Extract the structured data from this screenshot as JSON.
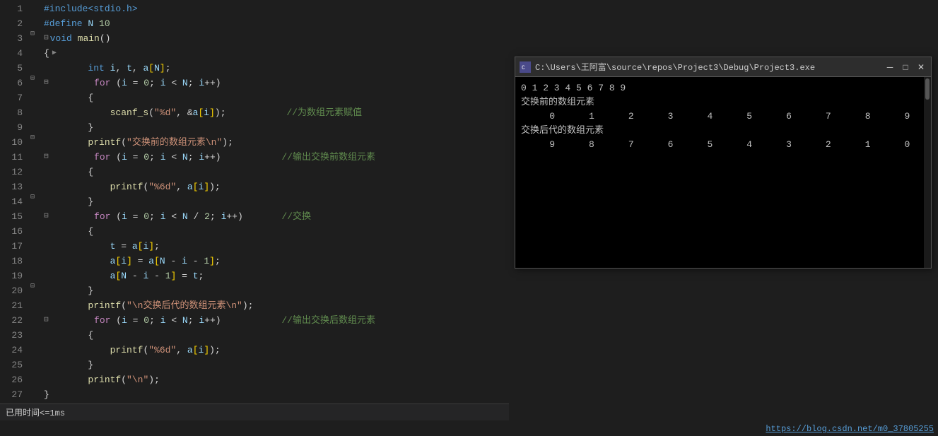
{
  "editor": {
    "background": "#1e1e1e",
    "lines": [
      {
        "num": 1,
        "fold": false,
        "content": [
          {
            "t": "pp",
            "v": "#include<stdio.h>"
          }
        ]
      },
      {
        "num": 2,
        "fold": false,
        "content": [
          {
            "t": "pp",
            "v": "#define "
          },
          {
            "t": "var",
            "v": "N"
          },
          {
            "t": "plain",
            "v": " "
          },
          {
            "t": "num",
            "v": "10"
          }
        ]
      },
      {
        "num": 3,
        "fold": true,
        "content": [
          {
            "t": "kw",
            "v": "void"
          },
          {
            "t": "plain",
            "v": " "
          },
          {
            "t": "fn",
            "v": "main"
          },
          {
            "t": "plain",
            "v": "()"
          }
        ]
      },
      {
        "num": 4,
        "fold": false,
        "content": [
          {
            "t": "plain",
            "v": "{"
          },
          {
            "t": "plain",
            "v": " "
          },
          {
            "t": "plain",
            "v": "▶"
          }
        ]
      },
      {
        "num": 5,
        "fold": false,
        "content": [
          {
            "t": "plain",
            "v": "        "
          },
          {
            "t": "kw",
            "v": "int"
          },
          {
            "t": "plain",
            "v": " "
          },
          {
            "t": "var",
            "v": "i"
          },
          {
            "t": "plain",
            "v": ", "
          },
          {
            "t": "var",
            "v": "t"
          },
          {
            "t": "plain",
            "v": ", "
          },
          {
            "t": "var",
            "v": "a"
          },
          {
            "t": "bracket",
            "v": "["
          },
          {
            "t": "var",
            "v": "N"
          },
          {
            "t": "bracket",
            "v": "]"
          },
          {
            "t": "plain",
            "v": ";"
          }
        ]
      },
      {
        "num": 6,
        "fold": true,
        "content": [
          {
            "t": "plain",
            "v": "        "
          },
          {
            "t": "kw2",
            "v": "for"
          },
          {
            "t": "plain",
            "v": " ("
          },
          {
            "t": "var",
            "v": "i"
          },
          {
            "t": "plain",
            "v": " = "
          },
          {
            "t": "num",
            "v": "0"
          },
          {
            "t": "plain",
            "v": "; "
          },
          {
            "t": "var",
            "v": "i"
          },
          {
            "t": "plain",
            "v": " < "
          },
          {
            "t": "var",
            "v": "N"
          },
          {
            "t": "plain",
            "v": "; "
          },
          {
            "t": "var",
            "v": "i"
          },
          {
            "t": "plain",
            "v": "++)"
          }
        ]
      },
      {
        "num": 7,
        "fold": false,
        "content": [
          {
            "t": "plain",
            "v": "        {"
          }
        ]
      },
      {
        "num": 8,
        "fold": false,
        "content": [
          {
            "t": "plain",
            "v": "            "
          },
          {
            "t": "fn",
            "v": "scanf_s"
          },
          {
            "t": "plain",
            "v": "("
          },
          {
            "t": "str",
            "v": "\"%d\""
          },
          {
            "t": "plain",
            "v": ", &"
          },
          {
            "t": "var",
            "v": "a"
          },
          {
            "t": "bracket",
            "v": "["
          },
          {
            "t": "var",
            "v": "i"
          },
          {
            "t": "bracket",
            "v": "]"
          },
          {
            "t": "plain",
            "v": ");           "
          },
          {
            "t": "comment",
            "v": "//为数组元素赋值"
          }
        ]
      },
      {
        "num": 9,
        "fold": false,
        "content": [
          {
            "t": "plain",
            "v": "        }"
          }
        ]
      },
      {
        "num": 10,
        "fold": false,
        "content": [
          {
            "t": "plain",
            "v": "        "
          },
          {
            "t": "fn",
            "v": "printf"
          },
          {
            "t": "plain",
            "v": "("
          },
          {
            "t": "str",
            "v": "\"交换前的数组元素\\n\""
          },
          {
            "t": "plain",
            "v": ");"
          }
        ]
      },
      {
        "num": 11,
        "fold": true,
        "content": [
          {
            "t": "plain",
            "v": "        "
          },
          {
            "t": "kw2",
            "v": "for"
          },
          {
            "t": "plain",
            "v": " ("
          },
          {
            "t": "var",
            "v": "i"
          },
          {
            "t": "plain",
            "v": " = "
          },
          {
            "t": "num",
            "v": "0"
          },
          {
            "t": "plain",
            "v": "; "
          },
          {
            "t": "var",
            "v": "i"
          },
          {
            "t": "plain",
            "v": " < "
          },
          {
            "t": "var",
            "v": "N"
          },
          {
            "t": "plain",
            "v": "; "
          },
          {
            "t": "var",
            "v": "i"
          },
          {
            "t": "plain",
            "v": "++)           "
          },
          {
            "t": "comment",
            "v": "//输出交换前数组元素"
          }
        ]
      },
      {
        "num": 12,
        "fold": false,
        "content": [
          {
            "t": "plain",
            "v": "        {"
          }
        ]
      },
      {
        "num": 13,
        "fold": false,
        "content": [
          {
            "t": "plain",
            "v": "            "
          },
          {
            "t": "fn",
            "v": "printf"
          },
          {
            "t": "plain",
            "v": "("
          },
          {
            "t": "str",
            "v": "\"%6d\""
          },
          {
            "t": "plain",
            "v": ", "
          },
          {
            "t": "var",
            "v": "a"
          },
          {
            "t": "bracket",
            "v": "["
          },
          {
            "t": "var",
            "v": "i"
          },
          {
            "t": "bracket",
            "v": "]"
          },
          {
            "t": "plain",
            "v": ");"
          }
        ]
      },
      {
        "num": 14,
        "fold": false,
        "content": [
          {
            "t": "plain",
            "v": "        }"
          }
        ]
      },
      {
        "num": 15,
        "fold": true,
        "content": [
          {
            "t": "plain",
            "v": "        "
          },
          {
            "t": "kw2",
            "v": "for"
          },
          {
            "t": "plain",
            "v": " ("
          },
          {
            "t": "var",
            "v": "i"
          },
          {
            "t": "plain",
            "v": " = "
          },
          {
            "t": "num",
            "v": "0"
          },
          {
            "t": "plain",
            "v": "; "
          },
          {
            "t": "var",
            "v": "i"
          },
          {
            "t": "plain",
            "v": " < "
          },
          {
            "t": "var",
            "v": "N"
          },
          {
            "t": "plain",
            "v": " / "
          },
          {
            "t": "num",
            "v": "2"
          },
          {
            "t": "plain",
            "v": "; "
          },
          {
            "t": "var",
            "v": "i"
          },
          {
            "t": "plain",
            "v": "++)       "
          },
          {
            "t": "comment",
            "v": "//交换"
          }
        ]
      },
      {
        "num": 16,
        "fold": false,
        "content": [
          {
            "t": "plain",
            "v": "        {"
          }
        ]
      },
      {
        "num": 17,
        "fold": false,
        "content": [
          {
            "t": "plain",
            "v": "            "
          },
          {
            "t": "var",
            "v": "t"
          },
          {
            "t": "plain",
            "v": " = "
          },
          {
            "t": "var",
            "v": "a"
          },
          {
            "t": "bracket",
            "v": "["
          },
          {
            "t": "var",
            "v": "i"
          },
          {
            "t": "bracket",
            "v": "]"
          },
          {
            "t": "plain",
            "v": ";"
          }
        ]
      },
      {
        "num": 18,
        "fold": false,
        "content": [
          {
            "t": "plain",
            "v": "            "
          },
          {
            "t": "var",
            "v": "a"
          },
          {
            "t": "bracket",
            "v": "["
          },
          {
            "t": "var",
            "v": "i"
          },
          {
            "t": "bracket",
            "v": "]"
          },
          {
            "t": "plain",
            "v": " = "
          },
          {
            "t": "var",
            "v": "a"
          },
          {
            "t": "bracket",
            "v": "["
          },
          {
            "t": "var",
            "v": "N"
          },
          {
            "t": "plain",
            "v": " - "
          },
          {
            "t": "var",
            "v": "i"
          },
          {
            "t": "plain",
            "v": " - "
          },
          {
            "t": "num",
            "v": "1"
          },
          {
            "t": "bracket",
            "v": "]"
          },
          {
            "t": "plain",
            "v": ";"
          }
        ]
      },
      {
        "num": 19,
        "fold": false,
        "content": [
          {
            "t": "plain",
            "v": "            "
          },
          {
            "t": "var",
            "v": "a"
          },
          {
            "t": "bracket",
            "v": "["
          },
          {
            "t": "var",
            "v": "N"
          },
          {
            "t": "plain",
            "v": " - "
          },
          {
            "t": "var",
            "v": "i"
          },
          {
            "t": "plain",
            "v": " - "
          },
          {
            "t": "num",
            "v": "1"
          },
          {
            "t": "bracket",
            "v": "]"
          },
          {
            "t": "plain",
            "v": " = "
          },
          {
            "t": "var",
            "v": "t"
          },
          {
            "t": "plain",
            "v": ";"
          }
        ]
      },
      {
        "num": 20,
        "fold": false,
        "content": [
          {
            "t": "plain",
            "v": "        }"
          }
        ]
      },
      {
        "num": 21,
        "fold": false,
        "content": [
          {
            "t": "plain",
            "v": "        "
          },
          {
            "t": "fn",
            "v": "printf"
          },
          {
            "t": "plain",
            "v": "("
          },
          {
            "t": "str",
            "v": "\"\\n交换后代的数组元素\\n\""
          },
          {
            "t": "plain",
            "v": ");"
          }
        ]
      },
      {
        "num": 22,
        "fold": true,
        "content": [
          {
            "t": "plain",
            "v": "        "
          },
          {
            "t": "kw2",
            "v": "for"
          },
          {
            "t": "plain",
            "v": " ("
          },
          {
            "t": "var",
            "v": "i"
          },
          {
            "t": "plain",
            "v": " = "
          },
          {
            "t": "num",
            "v": "0"
          },
          {
            "t": "plain",
            "v": "; "
          },
          {
            "t": "var",
            "v": "i"
          },
          {
            "t": "plain",
            "v": " < "
          },
          {
            "t": "var",
            "v": "N"
          },
          {
            "t": "plain",
            "v": "; "
          },
          {
            "t": "var",
            "v": "i"
          },
          {
            "t": "plain",
            "v": "++)           "
          },
          {
            "t": "comment",
            "v": "//输出交换后数组元素"
          }
        ]
      },
      {
        "num": 23,
        "fold": false,
        "content": [
          {
            "t": "plain",
            "v": "        {"
          }
        ]
      },
      {
        "num": 24,
        "fold": false,
        "content": [
          {
            "t": "plain",
            "v": "            "
          },
          {
            "t": "fn",
            "v": "printf"
          },
          {
            "t": "plain",
            "v": "("
          },
          {
            "t": "str",
            "v": "\"%6d\""
          },
          {
            "t": "plain",
            "v": ", "
          },
          {
            "t": "var",
            "v": "a"
          },
          {
            "t": "bracket",
            "v": "["
          },
          {
            "t": "var",
            "v": "i"
          },
          {
            "t": "bracket",
            "v": "]"
          },
          {
            "t": "plain",
            "v": ");"
          }
        ]
      },
      {
        "num": 25,
        "fold": false,
        "content": [
          {
            "t": "plain",
            "v": "        }"
          }
        ]
      },
      {
        "num": 26,
        "fold": false,
        "content": [
          {
            "t": "plain",
            "v": "        "
          },
          {
            "t": "fn",
            "v": "printf"
          },
          {
            "t": "plain",
            "v": "("
          },
          {
            "t": "str",
            "v": "\"\\n\""
          },
          {
            "t": "plain",
            "v": ");"
          }
        ]
      },
      {
        "num": 27,
        "fold": false,
        "content": [
          {
            "t": "plain",
            "v": "}"
          }
        ]
      }
    ],
    "error_lines": [
      26,
      27
    ],
    "status": "已用时间<=1ms"
  },
  "terminal": {
    "title": "C:\\Users\\王阿富\\source\\repos\\Project3\\Debug\\Project3.exe",
    "icon": "█",
    "controls": {
      "minimize": "─",
      "maximize": "□",
      "close": "✕"
    },
    "output": {
      "line1": "0 1 2 3 4 5 6 7 8 9",
      "line2": "交换前的数组元素",
      "line3_label": "     0",
      "line3_nums": "     1     2     3     4     5     6     7     8     9",
      "line4": "交换后代的数组元素",
      "line5_label": "     9",
      "line5_nums": "     8     7     6     5     4     3     2     1     0"
    }
  },
  "url": "https://blog.csdn.net/m0_37805255"
}
